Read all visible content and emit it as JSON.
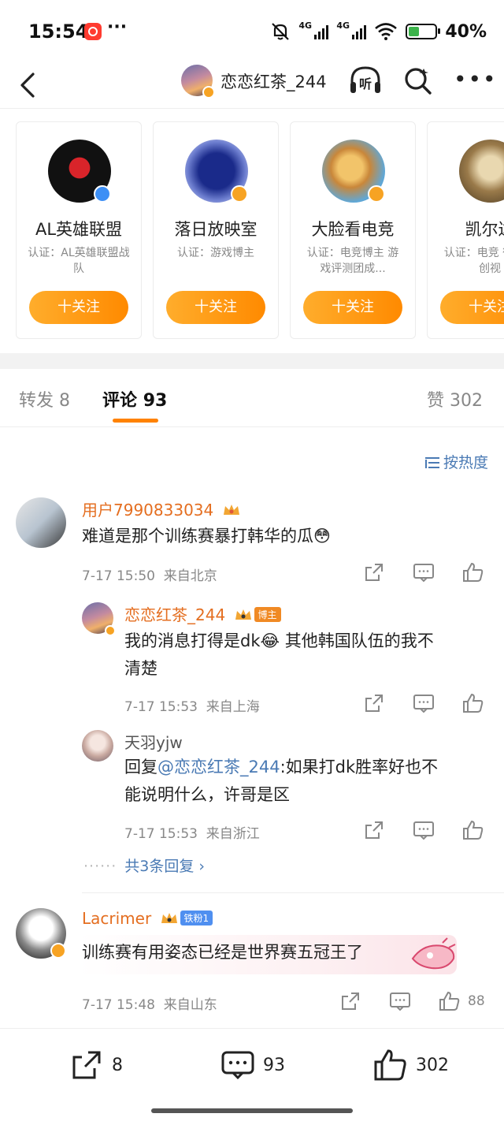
{
  "status_bar": {
    "time": "15:54",
    "dots": "···",
    "net1": "4G",
    "net2": "4G",
    "battery_level": 0.4,
    "battery_pct": "40%"
  },
  "nav": {
    "username": "恋恋红茶_244",
    "listen_label": "听"
  },
  "recommended": [
    {
      "name": "AL英雄联盟",
      "cert": "认证：AL英雄联盟战队",
      "badge": "blue",
      "follow": "十关注"
    },
    {
      "name": "落日放映室",
      "cert": "认证：游戏博主",
      "badge": "orange",
      "follow": "十关注"
    },
    {
      "name": "大脸看电竞",
      "cert": "认证：电竞博主 游戏评测团成...",
      "badge": "orange",
      "follow": "十关注"
    },
    {
      "name": "凯尔达",
      "cert": "认证：电竞 微博原创视",
      "badge": "none",
      "follow": "十关注"
    }
  ],
  "tabs": {
    "repost_label": "转发",
    "repost_count": "8",
    "comment_label": "评论",
    "comment_count": "93",
    "like_label": "赞",
    "like_count": "302"
  },
  "sort_label": "按热度",
  "comments": [
    {
      "user": "用户7990833034",
      "text": "难道是那个训练赛暴打韩华的瓜😳",
      "time": "7-17 15:50",
      "location": "来自北京"
    },
    {
      "user": "恋恋红茶_244",
      "tag": "博主",
      "text_line1": "我的消息打得是dk😂 其他韩国队伍的我不",
      "text_line2": "清楚",
      "time": "7-17 15:53",
      "location": "来自上海"
    },
    {
      "user": "天羽yjw",
      "reply_prefix": "回复",
      "mention": "@恋恋红茶_244",
      "text_line1_rest": ":如果打dk胜率好也不",
      "text_line2": "能说明什么，许哥是区",
      "time": "7-17 15:53",
      "location": "来自浙江"
    },
    {
      "user": "Lacrimer",
      "tag": "铁粉1",
      "text": "训练赛有用姿态已经是世界赛五冠王了",
      "time": "7-17 15:48",
      "location": "来自山东",
      "likes": "88"
    }
  ],
  "more_replies": {
    "dots": "······",
    "label": "共3条回复 ›"
  },
  "bottom_bar": {
    "repost": "8",
    "comment": "93",
    "like": "302"
  },
  "colors": {
    "accent": "#ff8200",
    "username": "#e46e20",
    "link": "#4a7ab4"
  }
}
